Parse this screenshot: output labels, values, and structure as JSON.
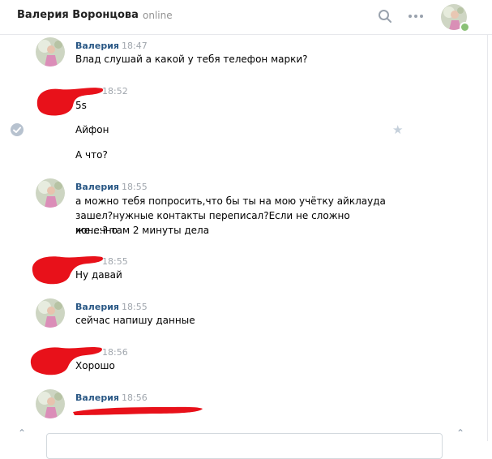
{
  "header": {
    "title": "Валерия Воронцова",
    "status": "online"
  },
  "messages": [
    {
      "name": "Валерия",
      "time": "18:47",
      "lines": [
        "Влад слушай а какой у тебя телефон марки?"
      ]
    },
    {
      "name": "",
      "time": "18:52",
      "lines": [
        "5s",
        "Айфон",
        "А что?"
      ]
    },
    {
      "name": "Валерия",
      "time": "18:55",
      "lines": [
        "а можно тебя попросить,что бы ты на мою учётку айклауда",
        "зашел?нужные контакты переписал?Если не сложно конечно",
        "же....? там 2 минуты дела"
      ]
    },
    {
      "name": "",
      "time": "18:55",
      "lines": [
        "Ну давай"
      ]
    },
    {
      "name": "Валерия",
      "time": "18:55",
      "lines": [
        "сейчас напишу данные"
      ]
    },
    {
      "name": "",
      "time": "18:56",
      "lines": [
        "Хорошо"
      ]
    },
    {
      "name": "Валерия",
      "time": "18:56",
      "lines": []
    }
  ],
  "icons": {
    "search": "search-icon",
    "more": "more-icon",
    "check": "check-icon",
    "star": "star-icon"
  },
  "colors": {
    "name_link": "#2a5885",
    "time": "#a0a6ad",
    "redaction": "#e8111a",
    "online_dot": "#8ac176"
  }
}
